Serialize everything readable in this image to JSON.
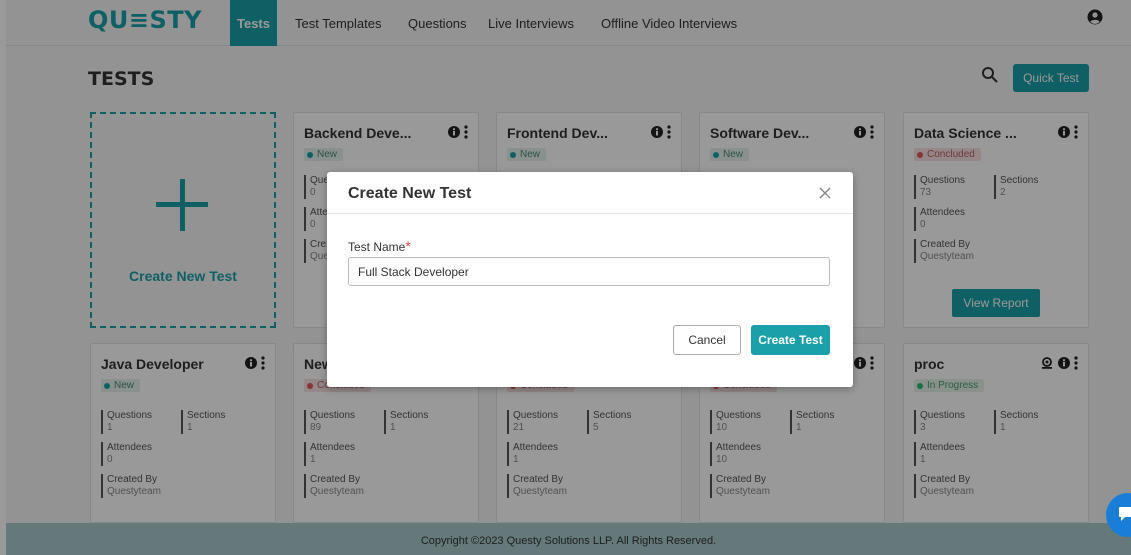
{
  "brand": {
    "logo": "QU≡STY",
    "accent": "#1aa0a8"
  },
  "nav": {
    "items": [
      {
        "label": "Tests",
        "active": true
      },
      {
        "label": "Test Templates",
        "active": false
      },
      {
        "label": "Questions",
        "active": false
      },
      {
        "label": "Live Interviews",
        "active": false
      },
      {
        "label": "Offline Video Interviews",
        "active": false
      }
    ],
    "user_icon": "user-circle-icon"
  },
  "page": {
    "title": "TESTS",
    "search_icon": "search-icon",
    "quick_test_label": "Quick Test",
    "create_new_label": "Create New Test"
  },
  "labels": {
    "questions": "Questions",
    "sections": "Sections",
    "attendees": "Attendees",
    "created_by": "Created By",
    "view_report": "View Report"
  },
  "cards": [
    {
      "title": "Backend Deve...",
      "status": "New",
      "questions": "0",
      "sections": "",
      "attendees": "0",
      "created_by": "Que"
    },
    {
      "title": "Frontend Dev...",
      "status": "New"
    },
    {
      "title": "Software Dev...",
      "status": "New"
    },
    {
      "title": "Data Science ...",
      "status": "Concluded",
      "questions": "73",
      "sections": "2",
      "attendees": "0",
      "created_by": "Questyteam",
      "action": "View Report"
    },
    {
      "title": "Java Developer",
      "status": "New",
      "questions": "1",
      "sections": "1",
      "attendees": "0",
      "created_by": "Questyteam"
    },
    {
      "title": "New",
      "status": "Concluded",
      "questions": "89",
      "sections": "1",
      "attendees": "1",
      "created_by": "Questyteam"
    },
    {
      "title": "",
      "status": "Concluded",
      "questions": "21",
      "sections": "5",
      "attendees": "1",
      "created_by": "Questyteam"
    },
    {
      "title": "",
      "status": "Concluded",
      "questions": "10",
      "sections": "1",
      "attendees": "10",
      "created_by": "Questyteam"
    },
    {
      "title": "proc",
      "status": "In Progress",
      "questions": "3",
      "sections": "1",
      "attendees": "1",
      "created_by": "Questyteam"
    }
  ],
  "modal": {
    "title": "Create New Test",
    "field_label": "Test Name",
    "required_mark": "*",
    "input_value": "Full Stack Developer",
    "cancel_label": "Cancel",
    "submit_label": "Create Test"
  },
  "footer": {
    "text": "Copyright ©2023 Questy Solutions LLP. All Rights Reserved."
  }
}
